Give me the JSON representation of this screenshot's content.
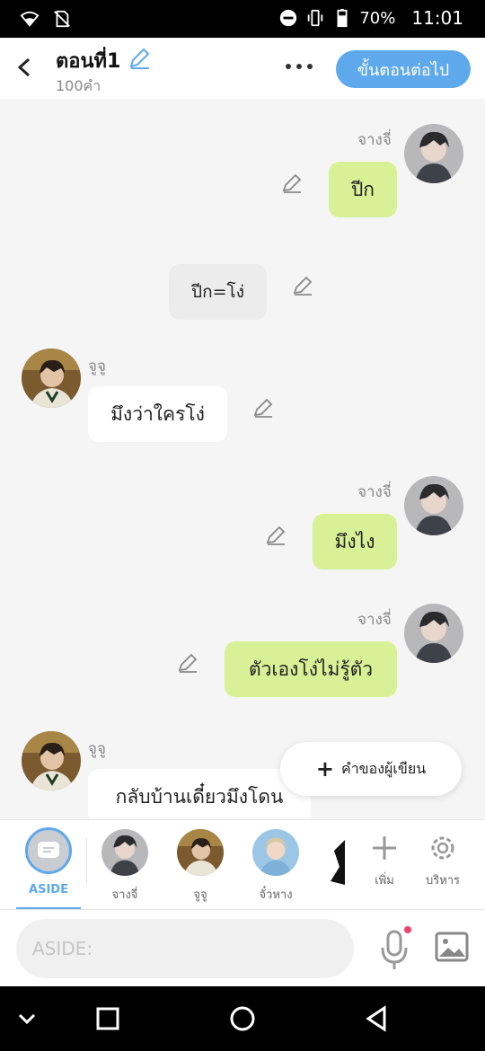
{
  "status_bar": {
    "battery": "70%",
    "time": "11:01"
  },
  "header": {
    "title": "ตอนที่1",
    "subtitle": "100คำ",
    "next_button": "ขั้นตอนต่อไป"
  },
  "messages": [
    {
      "side": "right",
      "speaker": "จางจี่",
      "text": "ปีก"
    },
    {
      "side": "center",
      "text": "ปีก=โง่"
    },
    {
      "side": "left",
      "speaker": "จูจู",
      "text": "มึงว่าใครโง่"
    },
    {
      "side": "right",
      "speaker": "จางจี่",
      "text": "มึงไง"
    },
    {
      "side": "right",
      "speaker": "จางจี่",
      "text": "ตัวเองโง่ไม่รู้ตัว"
    },
    {
      "side": "left",
      "speaker": "จูจู",
      "text": "กลับบ้านเดี๋ยวมึงโดน"
    }
  ],
  "writer_note_button": "คำของผู้เขียน",
  "character_bar": {
    "aside_label": "ASIDE",
    "characters": [
      "จางจี่",
      "จูจู",
      "จั๋วหาง"
    ],
    "add_label": "เพิ่ม",
    "manage_label": "บริหาร"
  },
  "input": {
    "placeholder": "ASIDE:"
  },
  "colors": {
    "accent": "#5ea9ec",
    "bubble_right": "#d9f196",
    "bubble_left": "#ffffff",
    "bubble_center": "#ececec"
  }
}
